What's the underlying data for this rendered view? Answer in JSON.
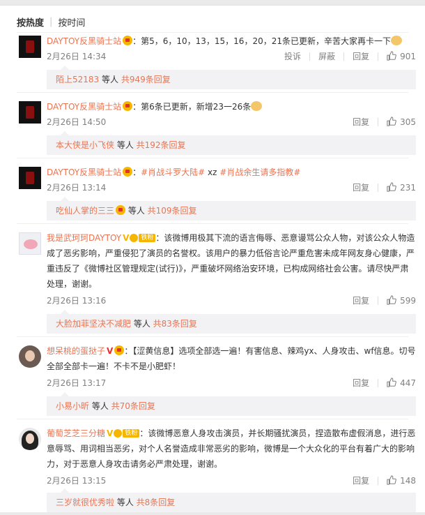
{
  "sort": {
    "hot": "按热度",
    "time": "按时间"
  },
  "comments": [
    {
      "user": "DAYTOY反黑骑士站",
      "text": "：第5，6，10，13，15，16，20，21条已更新，辛苦大家再卡一下",
      "time": "2月26日 14:34",
      "report": "投诉",
      "block": "屏蔽",
      "reply": "回复",
      "likes": "901",
      "reply_user": "陌上52183",
      "reply_mid": " 等人 ",
      "reply_count": "共949条回复"
    },
    {
      "user": "DAYTOY反黑骑士站",
      "text": "：第6条已更新，新增23一26条",
      "time": "2月26日 14:50",
      "reply": "回复",
      "likes": "305",
      "reply_user": "本大侠是小飞侠",
      "reply_mid": " 等人 ",
      "reply_count": "共192条回复"
    },
    {
      "user": "DAYTOY反黑骑士站",
      "colon": "：",
      "tag1": "#肖战斗罗大陆#",
      "mid": " xz ",
      "tag2": "#肖战余生请多指教#",
      "time": "2月26日 13:14",
      "reply": "回复",
      "likes": "231",
      "reply_user": "吃仙人掌的三三",
      "reply_mid": " 等人 ",
      "reply_count": "共109条回复"
    },
    {
      "user": "我是武珂珂DAYTOY",
      "fan_label": "铁粉",
      "text": "：该微博用极其下流的语言侮辱、恶意谩骂公众人物，对该公众人物造成了恶劣影响，严重侵犯了演员的名誉权。该用户的暴力低俗言论严重危害未成年网友身心健康，严重违反了《微博社区管理规定(试行)》，严重破坏网络治安环境，已构成网络社会公害。请尽快严肃处理，谢谢。",
      "time": "2月26日 13:16",
      "reply": "回复",
      "likes": "599",
      "reply_user": "大脸加菲坚决不减肥",
      "reply_mid": " 等人 ",
      "reply_count": "共83条回复"
    },
    {
      "user": "想呆桃的蛋挞子",
      "text": "：【涩黄信息】选项全部选一遍！有害信息、辣鸡yx、人身攻击、wf信息。切号全部全部卡一遍！不卡不是小肥虾！",
      "time": "2月26日 13:17",
      "reply": "回复",
      "likes": "447",
      "reply_user": "小易小昕",
      "reply_mid": " 等人 ",
      "reply_count": "共70条回复"
    },
    {
      "user": "葡萄芝芝三分糖",
      "fan_label": "铁粉",
      "text": "：该微博恶意人身攻击演员，并长期骚扰演员，捏造散布虚假消息，进行恶意辱骂、用词相当恶劣，对个人名誉造成非常恶劣的影响，微博是一个大众化的平台有着广大的影响力，对于恶意人身攻击请务必严肃处理，谢谢。",
      "time": "2月26日 13:15",
      "reply": "回复",
      "likes": "148",
      "reply_user": "三岁就很优秀啦",
      "reply_mid": " 等人 ",
      "reply_count": "共8条回复"
    }
  ]
}
